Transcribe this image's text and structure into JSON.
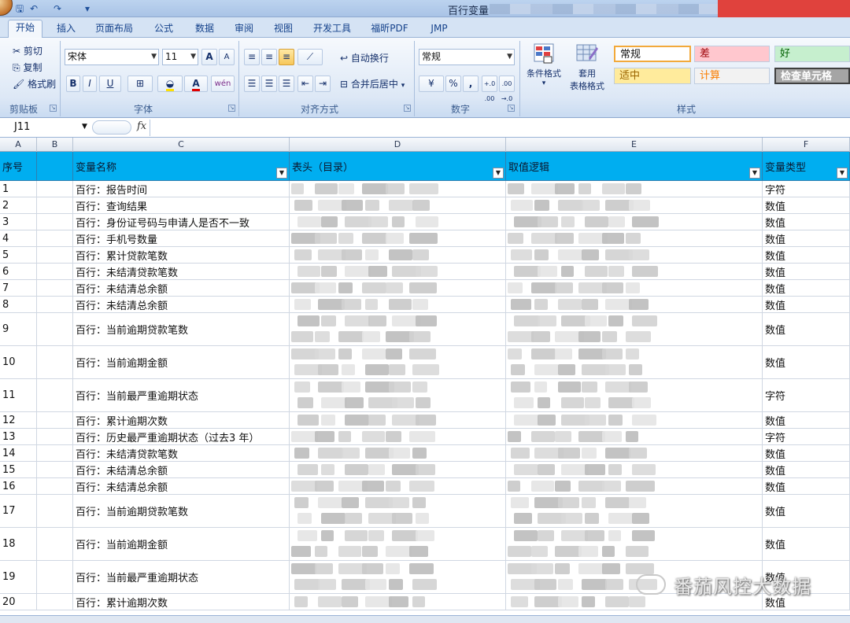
{
  "window": {
    "title": "百行变量"
  },
  "ribbon_tabs": [
    "开始",
    "插入",
    "页面布局",
    "公式",
    "数据",
    "审阅",
    "视图",
    "开发工具",
    "福昕PDF",
    "JMP"
  ],
  "ribbon": {
    "clipboard": {
      "cut": "剪切",
      "copy": "复制",
      "format_painter": "格式刷",
      "label": "剪贴板"
    },
    "font": {
      "name": "宋体",
      "size": "11",
      "label": "字体",
      "grow": "A",
      "shrink": "A",
      "bold": "B",
      "italic": "I",
      "underline": "U",
      "phonetic": "wén"
    },
    "alignment": {
      "wrap": "自动换行",
      "merge": "合并后居中",
      "label": "对齐方式"
    },
    "number": {
      "format": "常规",
      "percent": "%",
      "comma": ",",
      "inc": "+.0 .00",
      "dec": ".00 →.0",
      "label": "数字"
    },
    "styles_group": {
      "conditional": "条件格式",
      "table": "套用",
      "table2": "表格格式",
      "label": "样式",
      "cells": [
        {
          "text": "常规",
          "bg": "#ffffff",
          "fg": "#111111"
        },
        {
          "text": "差",
          "bg": "#ffc7ce",
          "fg": "#9c0006"
        },
        {
          "text": "好",
          "bg": "#c6efce",
          "fg": "#006100"
        },
        {
          "text": "适中",
          "bg": "#ffeb9c",
          "fg": "#9c6500"
        },
        {
          "text": "计算",
          "bg": "#f2f2f2",
          "fg": "#fa7d00"
        },
        {
          "text": "检查单元格",
          "bg": "#a5a5a5",
          "fg": "#ffffff"
        }
      ]
    }
  },
  "formula_bar": {
    "name_box": "J11",
    "fx": "fx",
    "content": ""
  },
  "columns": [
    "A",
    "B",
    "C",
    "D",
    "E",
    "F"
  ],
  "table": {
    "headers": {
      "a": "序号",
      "b": "",
      "c": "变量名称",
      "d": "表头（目录）",
      "e": "取值逻辑",
      "f": "变量类型"
    },
    "header_bg": "#00aef0",
    "rows": [
      {
        "no": "1",
        "name": "百行：报告时间",
        "type": "字符"
      },
      {
        "no": "2",
        "name": "百行：查询结果",
        "type": "数值"
      },
      {
        "no": "3",
        "name": "百行：身份证号码与申请人是否不一致",
        "type": "数值"
      },
      {
        "no": "4",
        "name": "百行：手机号数量",
        "type": "数值"
      },
      {
        "no": "5",
        "name": "百行：累计贷款笔数",
        "type": "数值"
      },
      {
        "no": "6",
        "name": "百行：未结清贷款笔数",
        "type": "数值"
      },
      {
        "no": "7",
        "name": "百行：未结清总余额",
        "type": "数值"
      },
      {
        "no": "8",
        "name": "百行：未结清总余额",
        "type": "数值"
      },
      {
        "no": "9",
        "name": "百行：当前逾期贷款笔数",
        "type": "数值"
      },
      {
        "no": "10",
        "name": "百行：当前逾期金额",
        "type": "数值"
      },
      {
        "no": "11",
        "name": "百行：当前最严重逾期状态",
        "type": "字符"
      },
      {
        "no": "12",
        "name": "百行：累计逾期次数",
        "type": "数值"
      },
      {
        "no": "13",
        "name": "百行：历史最严重逾期状态（过去3 年）",
        "type": "字符"
      },
      {
        "no": "14",
        "name": "百行：未结清贷款笔数",
        "type": "数值"
      },
      {
        "no": "15",
        "name": "百行：未结清总余额",
        "type": "数值"
      },
      {
        "no": "16",
        "name": "百行：未结清总余额",
        "type": "数值"
      },
      {
        "no": "17",
        "name": "百行：当前逾期贷款笔数",
        "type": "数值"
      },
      {
        "no": "18",
        "name": "百行：当前逾期金额",
        "type": "数值"
      },
      {
        "no": "19",
        "name": "百行：当前最严重逾期状态",
        "type": "数值"
      },
      {
        "no": "20",
        "name": "百行：累计逾期次数",
        "type": "数值"
      }
    ]
  },
  "watermark": {
    "text": "番茄风控大数据"
  }
}
